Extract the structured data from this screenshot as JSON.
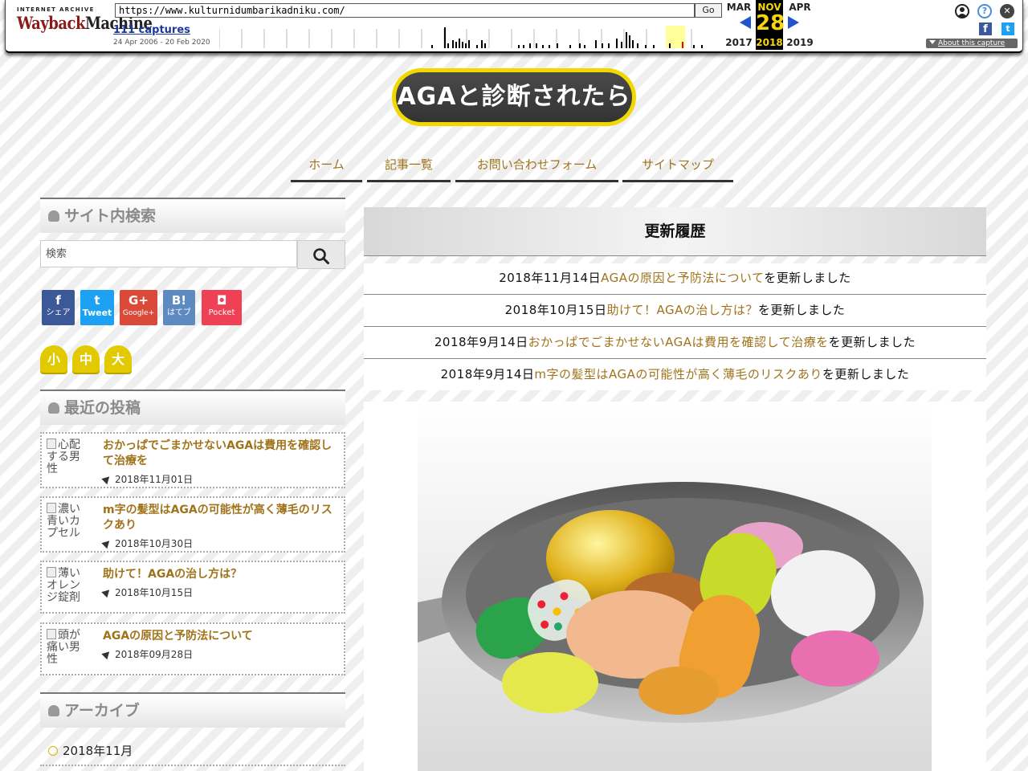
{
  "wayback": {
    "logo_top": "INTERNET ARCHIVE",
    "logo_main_a": "Wayback",
    "logo_main_b": "Machine",
    "url": "https://www.kulturnidumbarikadniku.com/",
    "go_label": "Go",
    "captures": "111 captures",
    "range": "24 Apr 2006 - 20 Feb 2020",
    "prev_month": "MAR",
    "cur_month": "NOV",
    "next_month": "APR",
    "prev_year": "2017",
    "cur_day": "28",
    "cur_year": "2018",
    "next_year": "2019",
    "about": "About this capture",
    "fb_glyph": "f",
    "tw_glyph": "t",
    "help_glyph": "?",
    "close_glyph": "✕",
    "icons": [
      "user-icon",
      "help-icon",
      "close-icon",
      "facebook-icon",
      "twitter-icon"
    ]
  },
  "site": {
    "title": "AGAと診断されたら"
  },
  "nav": [
    "ホーム",
    "記事一覧",
    "お問い合わせフォーム",
    "サイトマップ"
  ],
  "sidebar": {
    "search_title": "サイト内検索",
    "search_placeholder": "検索",
    "share": [
      {
        "glyph": "f",
        "label": "シェア",
        "color": "#3b5998"
      },
      {
        "glyph": "t",
        "label": "Tweet",
        "color": "#1da1f2"
      },
      {
        "glyph": "G+",
        "label": "Google+",
        "color": "#db4a39"
      },
      {
        "glyph": "B!",
        "label": "はてブ",
        "color": "#5d8ac1"
      },
      {
        "glyph": "◘",
        "label": "Pocket",
        "color": "#ef4056"
      }
    ],
    "font_sizes": [
      "小",
      "中",
      "大"
    ],
    "recent_title": "最近の投稿",
    "recent_posts": [
      {
        "alt": "心配する男性",
        "title": "おかっぱでごまかせないAGAは費用を確認して治療を",
        "date": "2018年11月01日"
      },
      {
        "alt": "濃い青いカプセル",
        "title": "m字の髪型はAGAの可能性が高く薄毛のリスクあり",
        "date": "2018年10月30日"
      },
      {
        "alt": "薄いオレンジ錠剤",
        "title": "助けて！AGAの治し方は？",
        "date": "2018年10月15日"
      },
      {
        "alt": "頭が痛い男性",
        "title": "AGAの原因と予防法について",
        "date": "2018年09月28日"
      }
    ],
    "archive_title": "アーカイブ",
    "archives": [
      "2018年11月"
    ]
  },
  "main": {
    "updates_title": "更新履歴",
    "suffix": "を更新しました",
    "updates": [
      {
        "date": "2018年11月14日",
        "link": "AGAの原因と予防法について"
      },
      {
        "date": "2018年10月15日",
        "link": "助けて！AGAの治し方は？"
      },
      {
        "date": "2018年9月14日",
        "link": "おかっぱでごまかせないAGAは費用を確認して治療を"
      },
      {
        "date": "2018年9月14日",
        "link": "m字の髪型はAGAの可能性が高く薄毛のリスクあり"
      }
    ]
  },
  "colors": {
    "link": "#a0731b",
    "accent_yellow": "#f0d800",
    "wayback_blue": "#2255cc"
  }
}
